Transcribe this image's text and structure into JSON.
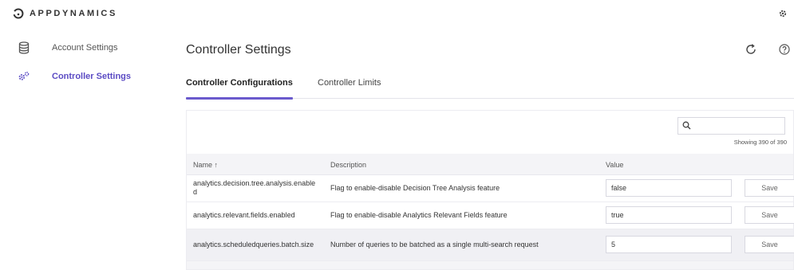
{
  "app": {
    "brand": "APPDYNAMICS",
    "accent": "#5b4bc4"
  },
  "topbar": {
    "settings_icon": "gear-icon"
  },
  "sidebar": {
    "items": [
      {
        "label": "Account Settings",
        "icon": "database-icon",
        "active": false
      },
      {
        "label": "Controller Settings",
        "icon": "gears-icon",
        "active": true
      }
    ]
  },
  "main": {
    "title": "Controller Settings",
    "refresh_icon": "refresh-icon",
    "help_icon": "help-icon",
    "tabs": [
      {
        "label": "Controller Configurations",
        "active": true
      },
      {
        "label": "Controller Limits",
        "active": false
      }
    ]
  },
  "search": {
    "value": "",
    "placeholder": "",
    "showing": "Showing 390 of 390"
  },
  "table": {
    "columns": {
      "name": "Name ↑",
      "description": "Description",
      "value": "Value"
    },
    "rows": [
      {
        "name": "analytics.decision.tree.analysis.enabled",
        "description": "Flag to enable-disable Decision Tree Analysis feature",
        "value": "false",
        "save": "Save"
      },
      {
        "name": "analytics.relevant.fields.enabled",
        "description": "Flag to enable-disable Analytics Relevant Fields feature",
        "value": "true",
        "save": "Save"
      },
      {
        "name": "analytics.scheduledqueries.batch.size",
        "description": "Number of queries to be batched as a single multi-search request",
        "value": "5",
        "save": "Save"
      }
    ]
  }
}
